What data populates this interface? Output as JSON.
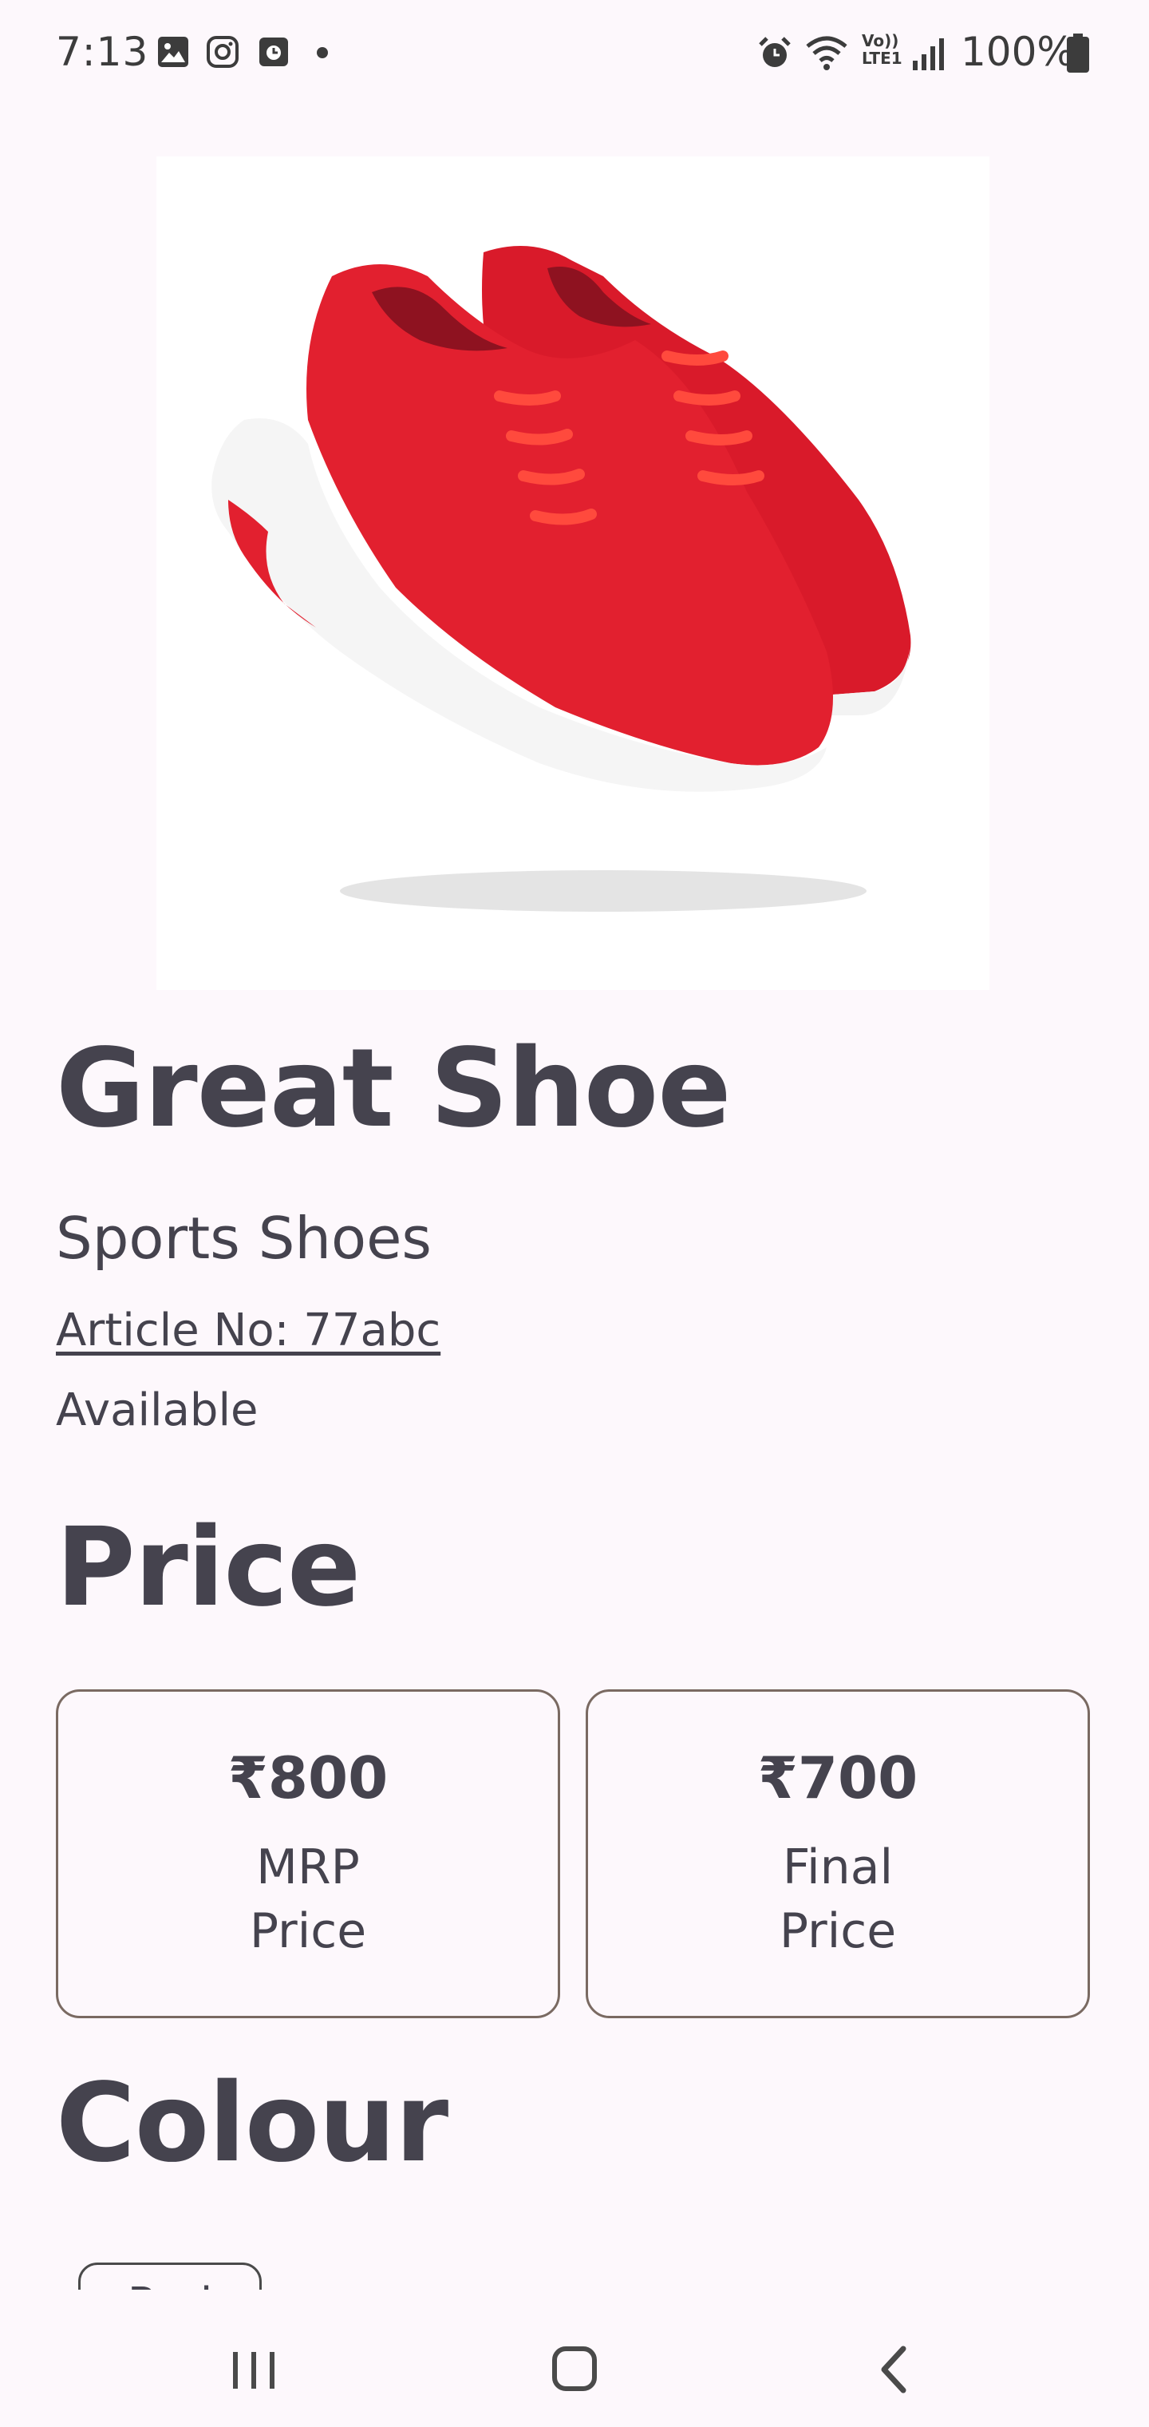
{
  "status_bar": {
    "time": "7:13",
    "left_icons": [
      "gallery-icon",
      "instagram-icon",
      "clock-app-icon",
      "dot-icon"
    ],
    "right_icons": [
      "alarm-icon",
      "wifi-icon",
      "volte-icon",
      "signal-icon",
      "battery-icon"
    ],
    "volte_text": "Vo))\nLTE1",
    "battery_text": "100%"
  },
  "product": {
    "image_alt": "red-sneakers-image",
    "name": "Great Shoe",
    "category": "Sports Shoes",
    "article": "Article No: 77abc",
    "availability": "Available"
  },
  "price_section": {
    "heading": "Price",
    "cards": [
      {
        "value": "₹800",
        "label": "MRP Price"
      },
      {
        "value": "₹700",
        "label": "Final Price"
      }
    ]
  },
  "colour_section": {
    "heading": "Colour",
    "chips": [
      "Red"
    ]
  },
  "nav_bar": {
    "buttons": [
      "recent-apps-icon",
      "home-icon",
      "back-icon"
    ]
  },
  "colors": {
    "background": "#fdf8fc",
    "text": "#45434e",
    "card_border": "#7a6a62",
    "shoe_red": "#e2202f"
  }
}
